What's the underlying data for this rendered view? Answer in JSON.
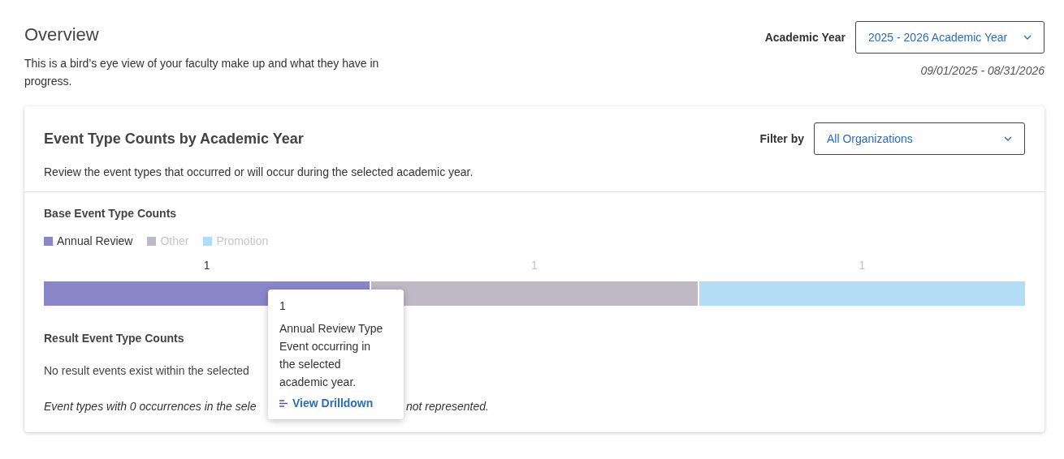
{
  "page": {
    "title": "Overview",
    "description": "This is a bird’s eye view of your faculty make up and what they have in progress."
  },
  "academic_year": {
    "label": "Academic Year",
    "value": "2025 - 2026 Academic Year",
    "date_range": "09/01/2025 - 08/31/2026"
  },
  "card": {
    "title": "Event Type Counts by Academic Year",
    "description": "Review the event types that occurred or will occur during the selected academic year.",
    "filter": {
      "label": "Filter by",
      "value": "All Organizations"
    },
    "base_section": {
      "title": "Base Event Type Counts",
      "segments": [
        {
          "label": "Annual Review",
          "count": "1",
          "color": "#8b86c8",
          "active": true
        },
        {
          "label": "Other",
          "count": "1",
          "color": "#bfb9c6",
          "active": false
        },
        {
          "label": "Promotion",
          "count": "1",
          "color": "#b3dcf7",
          "active": false
        }
      ]
    },
    "result_section": {
      "title": "Result Event Type Counts",
      "message": "No result events exist within the selected",
      "note_parts": [
        "Event types with 0 occurrences in the sele",
        "not represented."
      ]
    }
  },
  "tooltip": {
    "value": "1",
    "text": "Annual Review Type Event occurring in the selected academic year.",
    "link": "View Drilldown"
  }
}
